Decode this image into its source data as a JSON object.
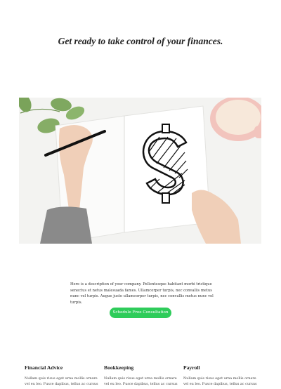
{
  "hero": {
    "title": "Get ready to take control of your finances."
  },
  "image": {
    "icon": "dollar-sign"
  },
  "description": {
    "text": "Here is a description of your company. Pellentesque habitant morbi tristique senectus et netus malesuada fames. Ullamcorper turpis, nec convallis metus nunc vel turpis. Augue justo ullamcorper turpis, nec convallis metus nunc vel turpis."
  },
  "cta": {
    "label": "Schedule Free Consultation",
    "color": "#2ecc5a"
  },
  "services": [
    {
      "title": "Financial Advice",
      "text": "Nullam quis risus eget urna mollis ornare vel eu leo. Fusce dapibus, tellus ac cursus"
    },
    {
      "title": "Bookkeeping",
      "text": "Nullam quis risus eget urna mollis ornare vel eu leo. Fusce dapibus, tellus ac cursus"
    },
    {
      "title": "Payroll",
      "text": "Nullam quis risus eget urna mollis ornare vel eu leo. Fusce dapibus, tellus ac cursus"
    }
  ]
}
